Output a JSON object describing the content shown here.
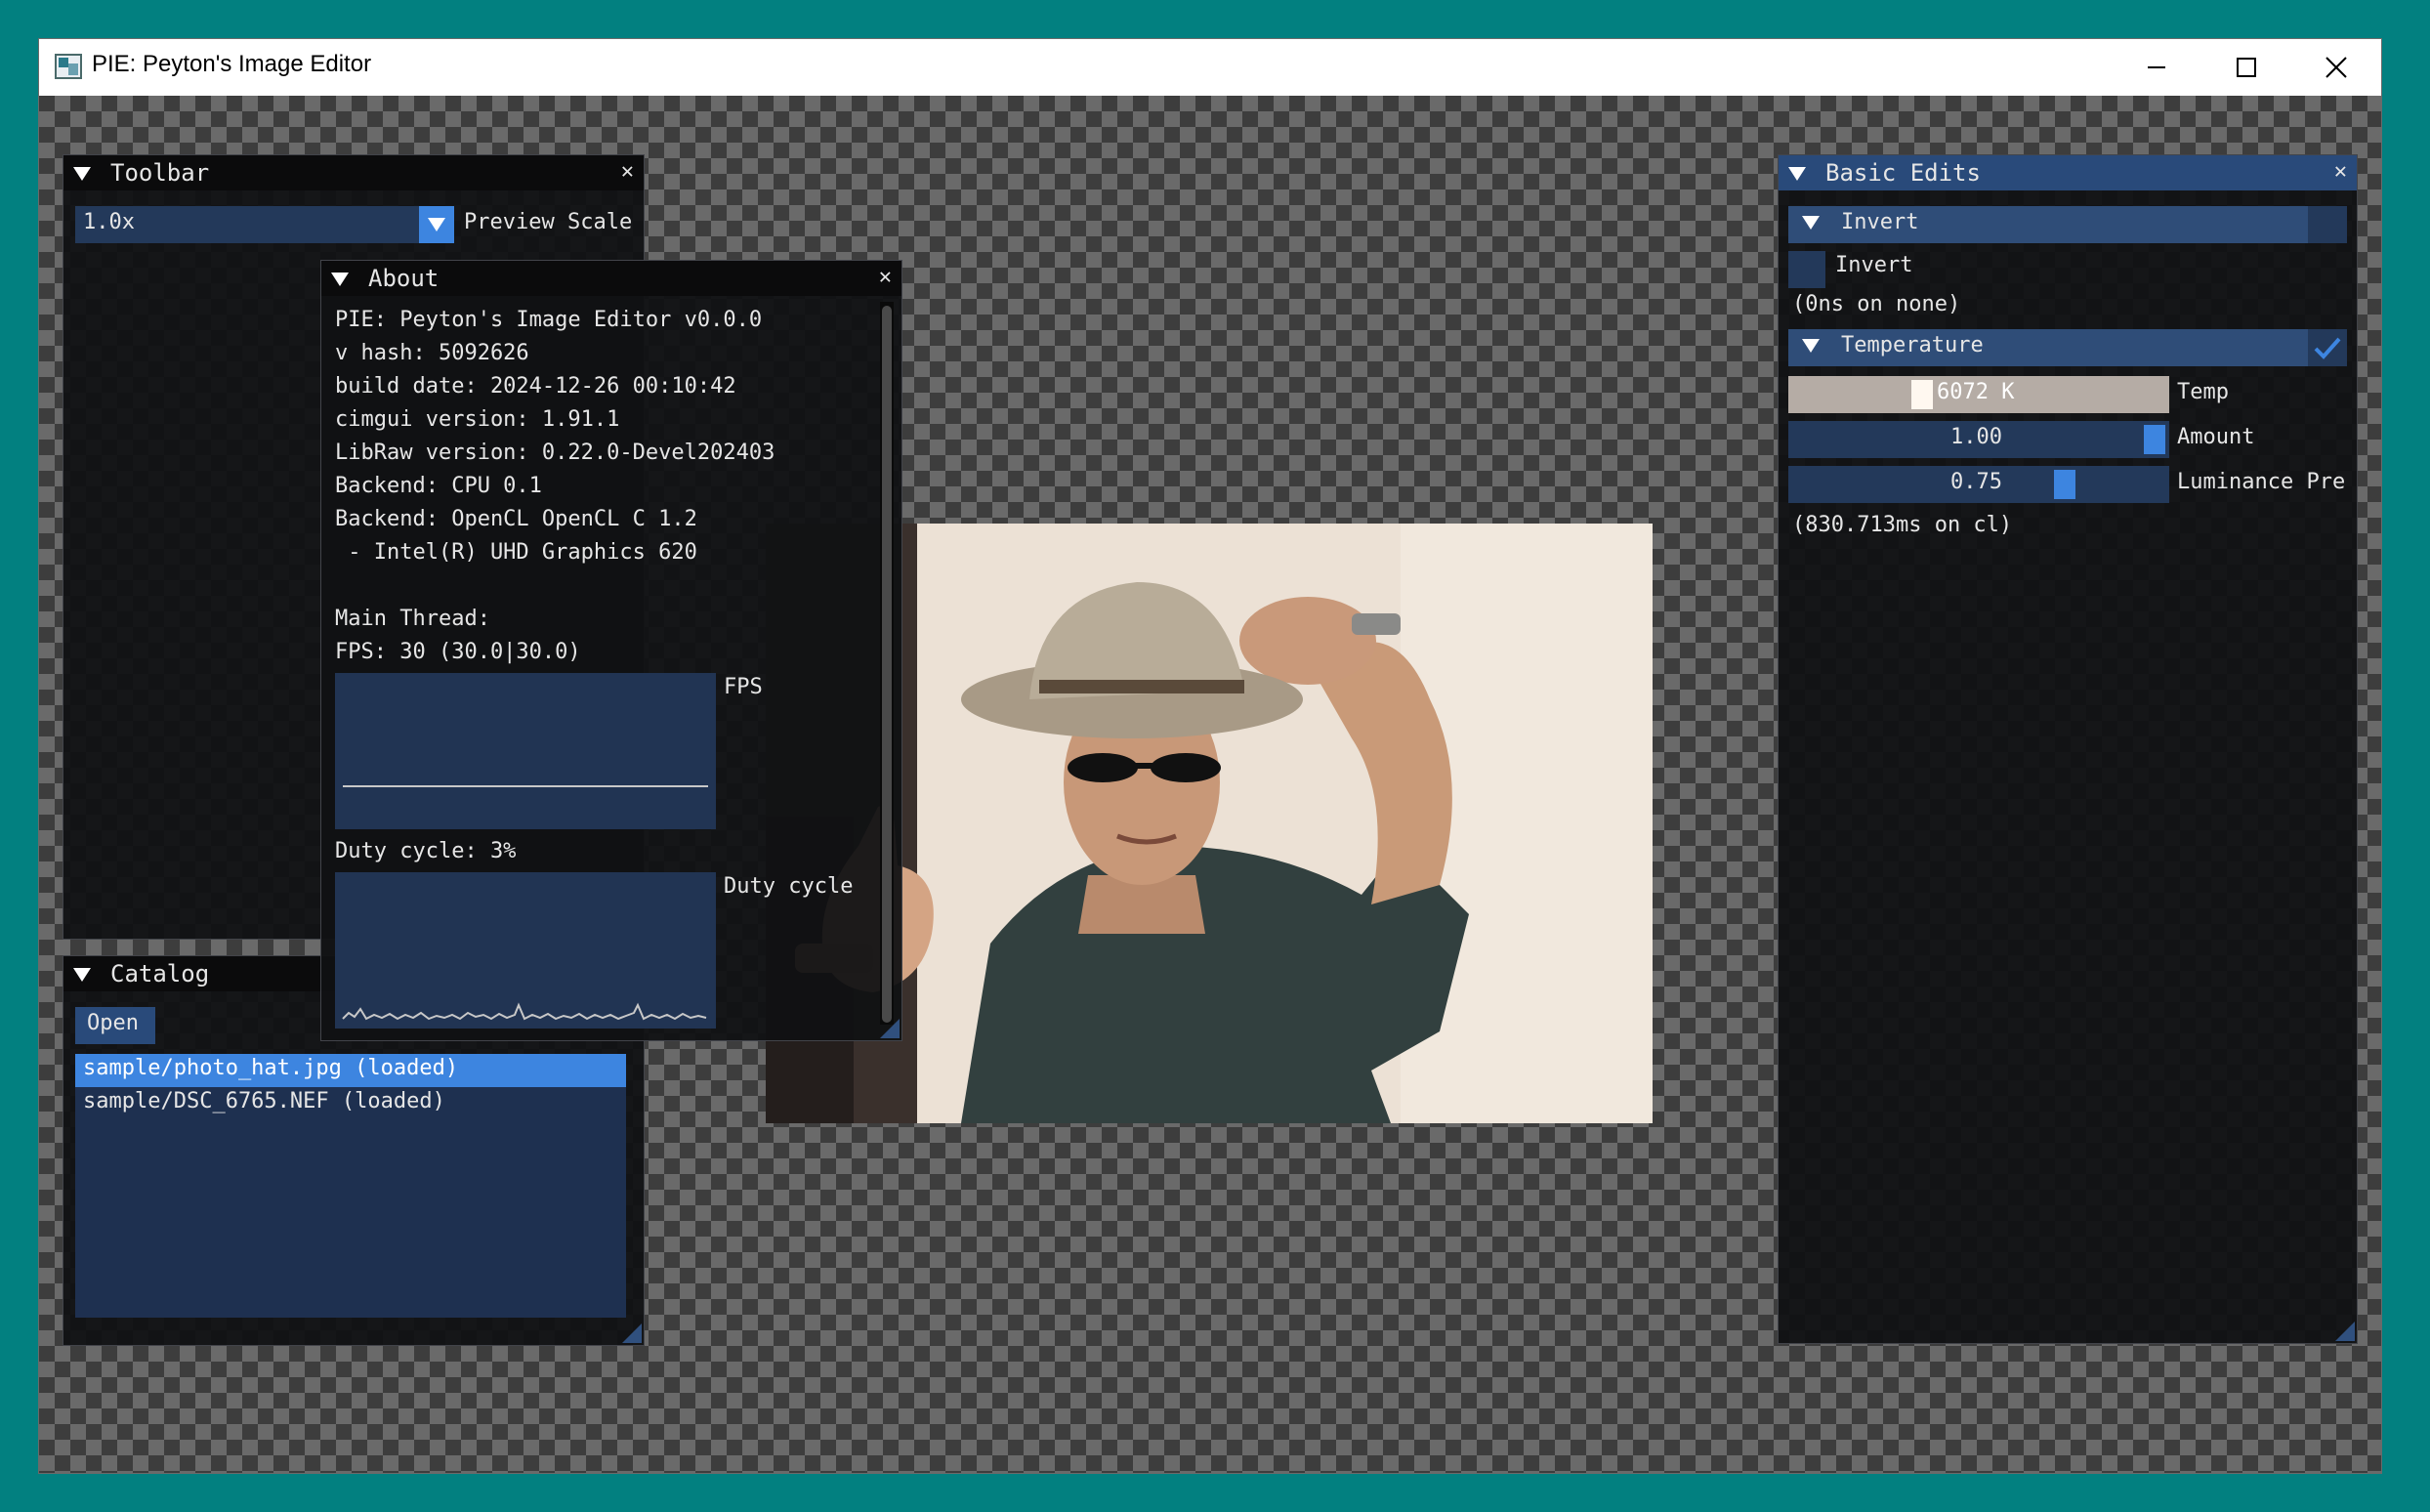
{
  "window": {
    "title": "PIE: Peyton's Image Editor"
  },
  "toolbar": {
    "title": "Toolbar",
    "close": "✕",
    "scale_value": "1.0x",
    "scale_label": "Preview Scale"
  },
  "about": {
    "title": "About",
    "close": "✕",
    "lines": [
      "PIE: Peyton's Image Editor v0.0.0",
      "v hash: 5092626",
      "build date: 2024-12-26 00:10:42",
      "cimgui version: 1.91.1",
      "LibRaw version: 0.22.0-Devel202403",
      "Backend: CPU 0.1",
      "Backend: OpenCL OpenCL C 1.2",
      " - Intel(R) UHD Graphics 620"
    ],
    "main_thread": "Main Thread:",
    "fps_text": "FPS: 30 (30.0|30.0)",
    "fps_label": "FPS",
    "duty_text": "Duty cycle: 3%",
    "duty_label": "Duty cycle"
  },
  "catalog": {
    "title": "Catalog",
    "open_label": "Open",
    "items": [
      "sample/photo_hat.jpg (loaded)",
      "sample/DSC_6765.NEF (loaded)"
    ]
  },
  "basic_edits": {
    "title": "Basic Edits",
    "close": "✕",
    "invert_header": "Invert",
    "invert_checkbox_label": "Invert",
    "invert_timing": "(0ns on none)",
    "temperature_header": "Temperature",
    "temp_value": "6072 K",
    "temp_label": "Temp",
    "amount_value": "1.00",
    "amount_label": "Amount",
    "luminance_value": "0.75",
    "luminance_label": "Luminance Pre",
    "temperature_timing": "(830.713ms on cl)"
  },
  "colors": {
    "accent": "#3d85e0",
    "title_active": "#294a7a",
    "frame_bg": "#23395a"
  }
}
